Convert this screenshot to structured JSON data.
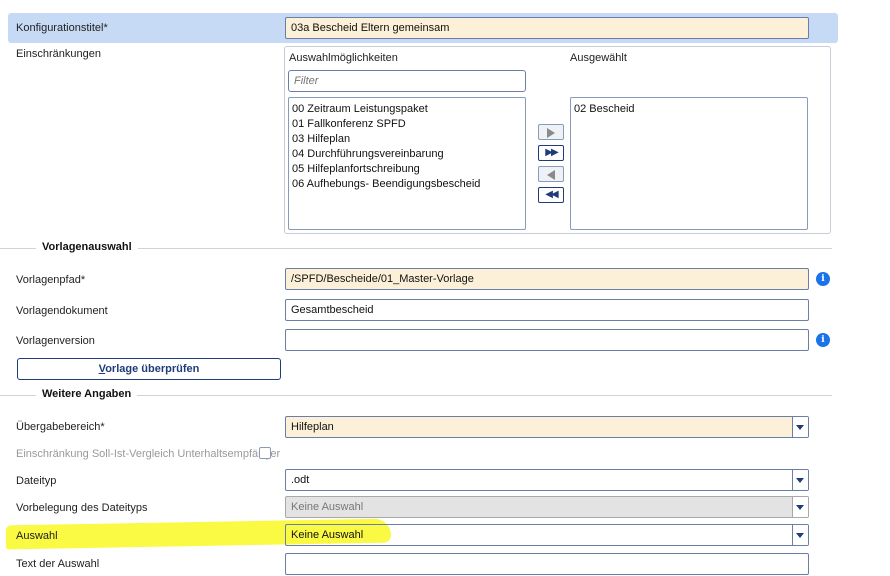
{
  "title_row": {
    "label": "Konfigurationstitel*",
    "value": "03a Bescheid Eltern gemeinsam"
  },
  "restrictions": {
    "label": "Einschränkungen",
    "available_header": "Auswahlmöglichkeiten",
    "selected_header": "Ausgewählt",
    "filter_placeholder": "Filter",
    "available": [
      "00 Zeitraum Leistungspaket",
      "01 Fallkonferenz SPFD",
      "03 Hilfeplan",
      "04 Durchführungsvereinbarung",
      "05 Hilfeplanfortschreibung",
      "06 Aufhebungs- Beendigungsbescheid"
    ],
    "selected": [
      "02 Bescheid"
    ],
    "buttons": {
      "move_right": "▶",
      "move_all_right": "▶▶",
      "move_left": "◀",
      "move_all_left": "◀◀"
    }
  },
  "template_section": {
    "title": "Vorlagenauswahl",
    "path_label": "Vorlagenpfad*",
    "path_value": "/SPFD/Bescheide/01_Master-Vorlage",
    "doc_label": "Vorlagendokument",
    "doc_value": "Gesamtbescheid",
    "version_label": "Vorlagenversion",
    "version_value": "",
    "check_button_prefix": "V",
    "check_button_rest": "orlage überprüfen",
    "info_glyph": "i"
  },
  "more_section": {
    "title": "Weitere Angaben",
    "handover_label": "Übergabebereich*",
    "handover_value": "Hilfeplan",
    "restriction_label": "Einschränkung Soll-Ist-Vergleich Unterhaltsempfänger",
    "filetype_label": "Dateityp",
    "filetype_value": ".odt",
    "prefill_label": "Vorbelegung des Dateityps",
    "prefill_value": "Keine Auswahl",
    "selection_label": "Auswahl",
    "selection_value": "Keine Auswahl",
    "selection_text_label": "Text der Auswahl",
    "selection_text_value": ""
  }
}
